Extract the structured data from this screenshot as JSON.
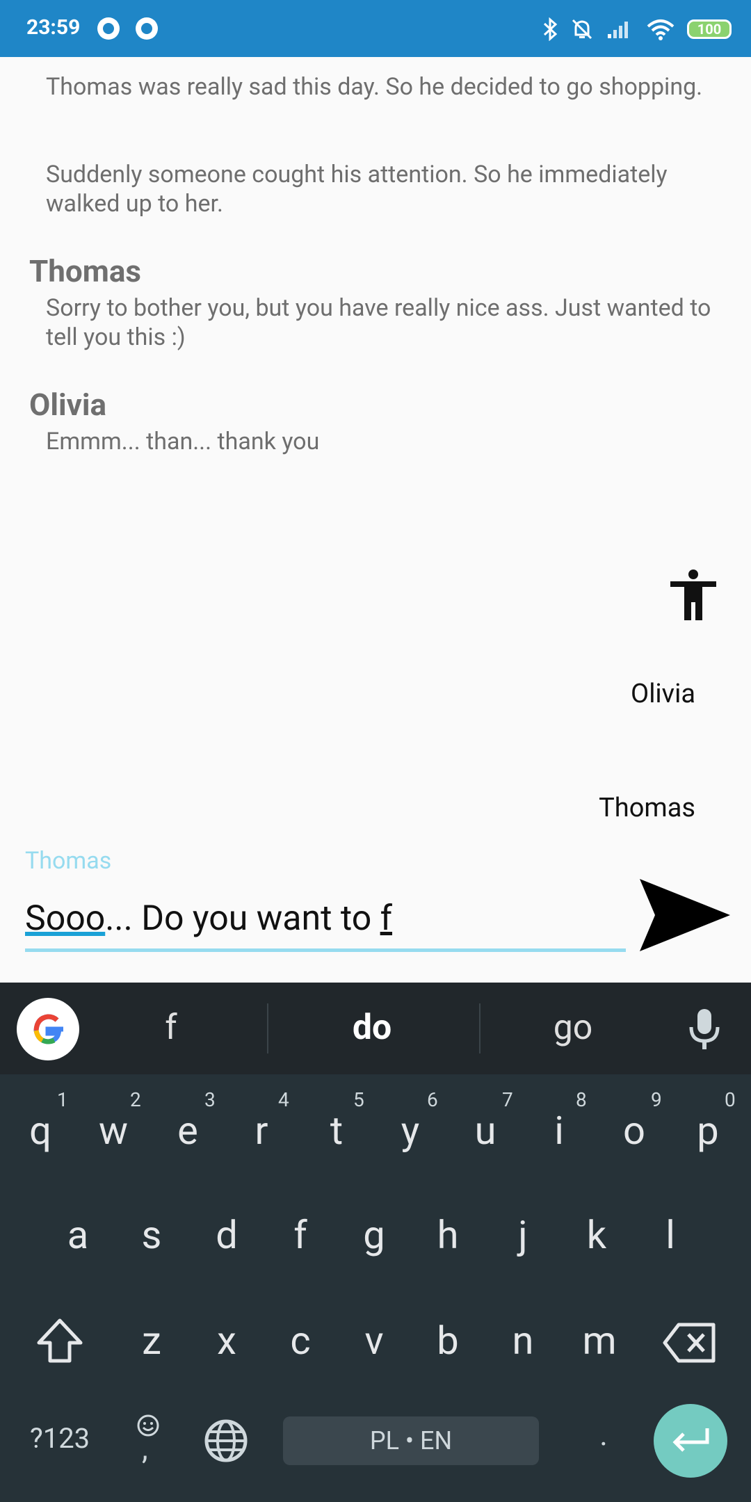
{
  "status_bar": {
    "time": "23:59",
    "battery": "100"
  },
  "story": {
    "narration_1": "Thomas was really sad this day. So he decided to go shopping.",
    "narration_2": "Suddenly someone cought his attention. So he immediately walked up to her.",
    "dialogue": [
      {
        "speaker": "Thomas",
        "text": "Sorry to bother you, but you have really nice ass. Just wanted to tell you this :)"
      },
      {
        "speaker": "Olivia",
        "text": "Emmm... than... thank you"
      }
    ]
  },
  "characters": [
    "Olivia",
    "Thomas"
  ],
  "composer": {
    "label": "Thomas",
    "value_part1": "Sooo",
    "value_part2": "... Do you want to ",
    "value_part3": "f"
  },
  "keyboard": {
    "suggestions": [
      "f",
      "do",
      "go"
    ],
    "row1": [
      "q",
      "w",
      "e",
      "r",
      "t",
      "y",
      "u",
      "i",
      "o",
      "p"
    ],
    "row1_hints": [
      "1",
      "2",
      "3",
      "4",
      "5",
      "6",
      "7",
      "8",
      "9",
      "0"
    ],
    "row2": [
      "a",
      "s",
      "d",
      "f",
      "g",
      "h",
      "j",
      "k",
      "l"
    ],
    "row3": [
      "z",
      "x",
      "c",
      "v",
      "b",
      "n",
      "m"
    ],
    "symbols_key": "?123",
    "emoji_comma": ",",
    "period": ".",
    "space_label": "PL • EN"
  },
  "colors": {
    "status_bar": "#1f86c7",
    "accent": "#96dbef",
    "keyboard_bg": "#263238",
    "enter_key": "#74cbc1"
  }
}
